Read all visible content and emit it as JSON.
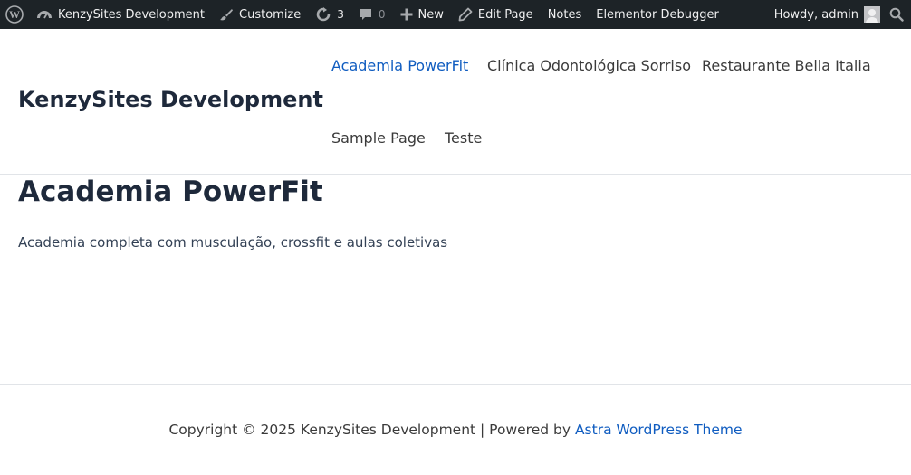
{
  "admin_bar": {
    "site_name": "KenzySites Development",
    "customize": "Customize",
    "updates_count": "3",
    "comments_count": "0",
    "new": "New",
    "edit_page": "Edit Page",
    "notes": "Notes",
    "debugger": "Elementor Debugger",
    "howdy": "Howdy, admin",
    "icons": [
      "wordpress-logo-icon",
      "dashboard-icon",
      "brush-icon",
      "updates-icon",
      "comment-icon",
      "plus-icon",
      "pencil-icon",
      "avatar",
      "search-icon"
    ]
  },
  "header": {
    "site_title": "KenzySites Development",
    "menu": [
      {
        "label": "Academia PowerFit",
        "current": true
      },
      {
        "label": "Clínica Odontológica Sorriso",
        "current": false
      },
      {
        "label": "Restaurante Bella Italia",
        "current": false
      },
      {
        "label": "Sample Page",
        "current": false
      },
      {
        "label": "Teste",
        "current": false
      }
    ]
  },
  "main": {
    "title": "Academia PowerFit",
    "content": "Academia completa com musculação, crossfit e aulas coletivas"
  },
  "footer": {
    "copyright": "Copyright © 2025 KenzySites Development | Powered by ",
    "theme_link": "Astra WordPress Theme"
  },
  "colors": {
    "admin_bar_bg": "#1d2327",
    "accent": "#0f5cc0",
    "heading": "#1e293b"
  }
}
